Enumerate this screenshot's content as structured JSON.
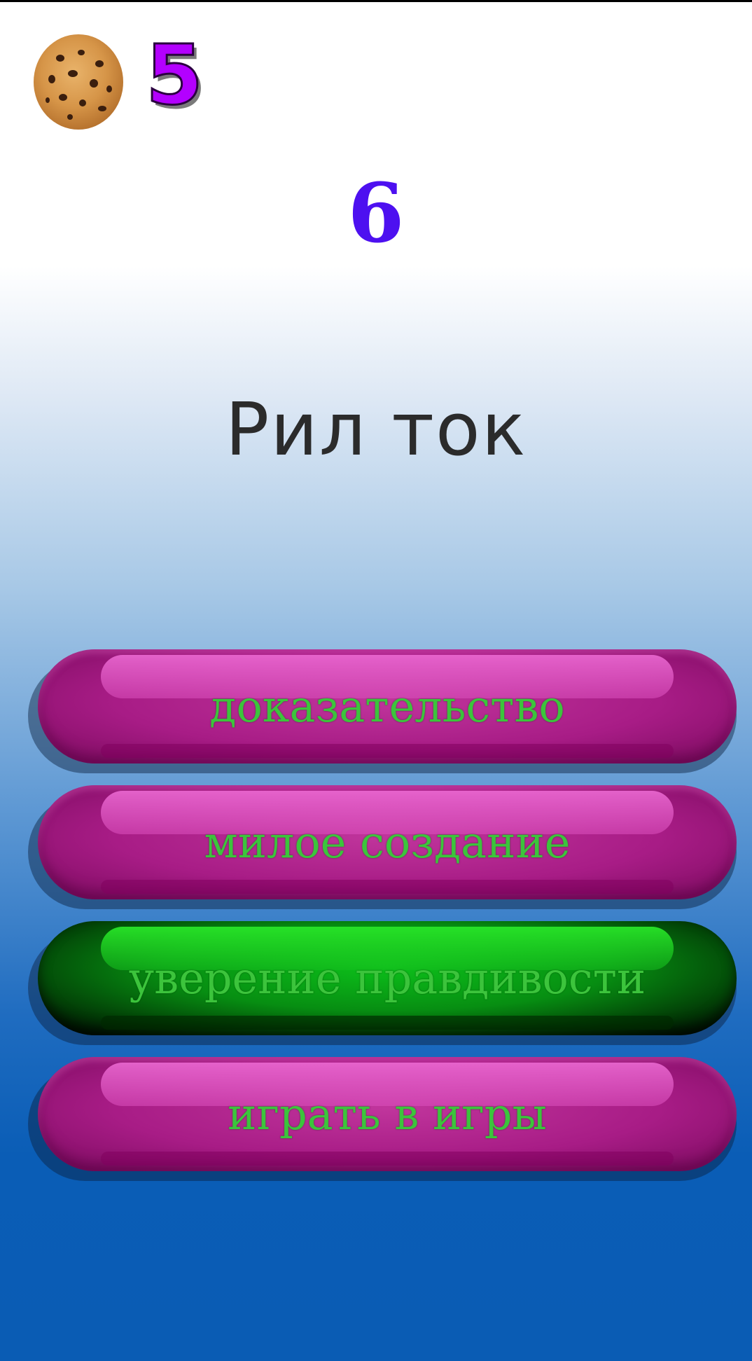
{
  "score": "5",
  "question_number": "6",
  "question": "Рил ток",
  "answers": [
    {
      "label": "доказательство",
      "state": "default"
    },
    {
      "label": "милое создание",
      "state": "default"
    },
    {
      "label": "уверение правдивости",
      "state": "selected"
    },
    {
      "label": "играть в игры",
      "state": "default"
    }
  ],
  "colors": {
    "score": "#b300ff",
    "question_number": "#4d10f0",
    "answer_text": "#3cc43c",
    "answer_button": "#a81c86",
    "answer_button_selected": "#078e12"
  },
  "icons": {
    "cookie": "cookie-icon"
  }
}
